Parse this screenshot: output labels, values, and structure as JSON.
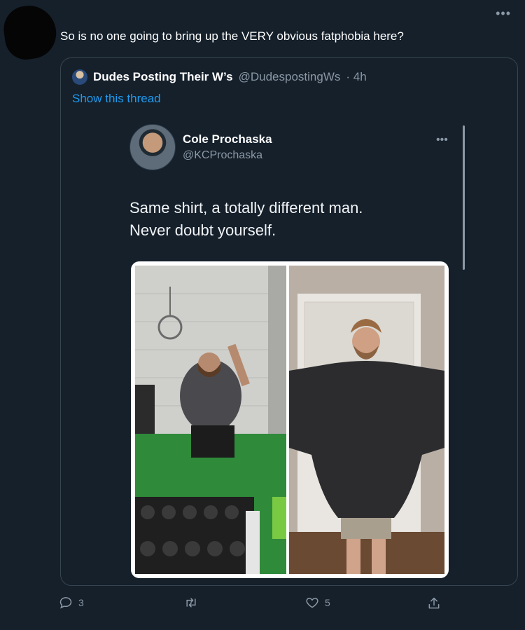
{
  "tweet": {
    "text": "So is no one going to bring up the VERY obvious fatphobia here?",
    "more_icon": "more-icon"
  },
  "quoted": {
    "author_name": "Dudes Posting Their W’s",
    "author_handle": "@DudespostingWs",
    "time": "· 4h",
    "show_thread": "Show this thread",
    "inner": {
      "author_name": "Cole Prochaska",
      "author_handle": "@KCProchaska",
      "text_line1": "Same shirt, a totally different man.",
      "text_line2": "Never doubt yourself."
    }
  },
  "actions": {
    "reply_count": "3",
    "retweet_count": "",
    "like_count": "5"
  },
  "colors": {
    "background": "#15202b",
    "link": "#1d9bf0",
    "muted": "#8b98a5",
    "border": "#38444d"
  }
}
